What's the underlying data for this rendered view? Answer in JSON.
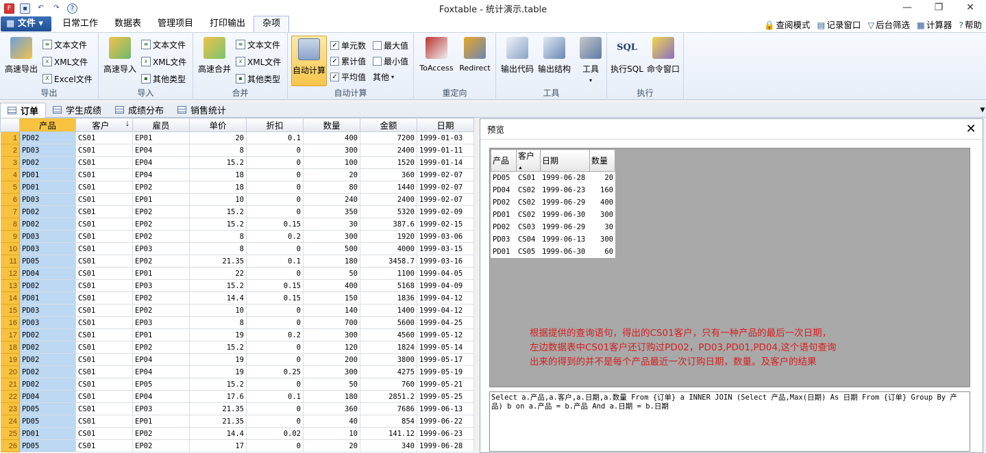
{
  "app": {
    "title": "Foxtable - 统计演示.table"
  },
  "menu": {
    "file": "文件",
    "tabs": [
      "日常工作",
      "数据表",
      "管理项目",
      "打印输出",
      "杂项"
    ],
    "active_tab": "杂项",
    "right_links": [
      "查阅模式",
      "记录窗口",
      "后台筛选",
      "计算器",
      "帮助"
    ]
  },
  "ribbon": {
    "export": {
      "label": "导出",
      "big": "高速导出",
      "small": [
        "文本文件",
        "XML文件",
        "Excel文件"
      ]
    },
    "import": {
      "label": "导入",
      "big": "高速导入",
      "small": [
        "文本文件",
        "XML文件",
        "其他类型"
      ]
    },
    "merge": {
      "label": "合并",
      "big": "高速合并",
      "small": [
        "文本文件",
        "XML文件",
        "其他类型"
      ]
    },
    "autocalc": {
      "label": "自动计算",
      "big": "自动计算",
      "checks": [
        "单元数",
        "累计值",
        "平均值"
      ],
      "checks2": [
        "最大值",
        "最小值"
      ],
      "other": "其他"
    },
    "redirect": {
      "label": "重定向",
      "items": [
        "ToAccess",
        "Redirect"
      ]
    },
    "tools": {
      "label": "工具",
      "items": [
        "输出代码",
        "输出结构",
        "工具"
      ]
    },
    "exec": {
      "label": "执行",
      "items": [
        "执行SQL",
        "命令窗口"
      ]
    }
  },
  "doc_tabs": [
    "订单",
    "学生成绩",
    "成绩分布",
    "销售统计"
  ],
  "grid": {
    "columns": [
      "产品",
      "客户",
      "雇员",
      "单价",
      "折扣",
      "数量",
      "金额",
      "日期"
    ],
    "rows": [
      [
        "1",
        "PD02",
        "CS01",
        "EP01",
        "20",
        "0.1",
        "400",
        "7200",
        "1999-01-03"
      ],
      [
        "2",
        "PD03",
        "CS01",
        "EP04",
        "8",
        "0",
        "300",
        "2400",
        "1999-01-11"
      ],
      [
        "3",
        "PD02",
        "CS01",
        "EP04",
        "15.2",
        "0",
        "100",
        "1520",
        "1999-01-14"
      ],
      [
        "4",
        "PD01",
        "CS01",
        "EP04",
        "18",
        "0",
        "20",
        "360",
        "1999-02-07"
      ],
      [
        "5",
        "PD01",
        "CS01",
        "EP02",
        "18",
        "0",
        "80",
        "1440",
        "1999-02-07"
      ],
      [
        "6",
        "PD03",
        "CS01",
        "EP01",
        "10",
        "0",
        "240",
        "2400",
        "1999-02-07"
      ],
      [
        "7",
        "PD02",
        "CS01",
        "EP02",
        "15.2",
        "0",
        "350",
        "5320",
        "1999-02-09"
      ],
      [
        "8",
        "PD02",
        "CS01",
        "EP02",
        "15.2",
        "0.15",
        "30",
        "387.6",
        "1999-02-15"
      ],
      [
        "9",
        "PD03",
        "CS01",
        "EP02",
        "8",
        "0.2",
        "300",
        "1920",
        "1999-03-06"
      ],
      [
        "10",
        "PD03",
        "CS01",
        "EP03",
        "8",
        "0",
        "500",
        "4000",
        "1999-03-15"
      ],
      [
        "11",
        "PD05",
        "CS01",
        "EP02",
        "21.35",
        "0.1",
        "180",
        "3458.7",
        "1999-03-16"
      ],
      [
        "12",
        "PD04",
        "CS01",
        "EP01",
        "22",
        "0",
        "50",
        "1100",
        "1999-04-05"
      ],
      [
        "13",
        "PD02",
        "CS01",
        "EP03",
        "15.2",
        "0.15",
        "400",
        "5168",
        "1999-04-09"
      ],
      [
        "14",
        "PD01",
        "CS01",
        "EP02",
        "14.4",
        "0.15",
        "150",
        "1836",
        "1999-04-12"
      ],
      [
        "15",
        "PD03",
        "CS01",
        "EP02",
        "10",
        "0",
        "140",
        "1400",
        "1999-04-12"
      ],
      [
        "16",
        "PD03",
        "CS01",
        "EP03",
        "8",
        "0",
        "700",
        "5600",
        "1999-04-25"
      ],
      [
        "17",
        "PD02",
        "CS01",
        "EP01",
        "19",
        "0.2",
        "300",
        "4560",
        "1999-05-12"
      ],
      [
        "18",
        "PD02",
        "CS01",
        "EP02",
        "15.2",
        "0",
        "120",
        "1824",
        "1999-05-14"
      ],
      [
        "19",
        "PD02",
        "CS01",
        "EP04",
        "19",
        "0",
        "200",
        "3800",
        "1999-05-17"
      ],
      [
        "20",
        "PD02",
        "CS01",
        "EP04",
        "19",
        "0.25",
        "300",
        "4275",
        "1999-05-19"
      ],
      [
        "21",
        "PD02",
        "CS01",
        "EP05",
        "15.2",
        "0",
        "50",
        "760",
        "1999-05-21"
      ],
      [
        "22",
        "PD04",
        "CS01",
        "EP04",
        "17.6",
        "0.1",
        "180",
        "2851.2",
        "1999-05-25"
      ],
      [
        "23",
        "PD05",
        "CS01",
        "EP03",
        "21.35",
        "0",
        "360",
        "7686",
        "1999-06-13"
      ],
      [
        "24",
        "PD05",
        "CS01",
        "EP01",
        "21.35",
        "0",
        "40",
        "854",
        "1999-06-22"
      ],
      [
        "25",
        "PD01",
        "CS01",
        "EP02",
        "14.4",
        "0.02",
        "10",
        "141.12",
        "1999-06-23"
      ],
      [
        "26",
        "PD05",
        "CS01",
        "EP02",
        "17",
        "0",
        "20",
        "340",
        "1999-06-28"
      ]
    ]
  },
  "preview": {
    "title": "预览",
    "columns": [
      "产品",
      "客户",
      "日期",
      "数量"
    ],
    "rows": [
      [
        "PD05",
        "CS01",
        "1999-06-28",
        "20"
      ],
      [
        "PD04",
        "CS02",
        "1999-06-23",
        "160"
      ],
      [
        "PD02",
        "CS02",
        "1999-06-29",
        "400"
      ],
      [
        "PD01",
        "CS02",
        "1999-06-30",
        "300"
      ],
      [
        "PD02",
        "CS03",
        "1999-06-29",
        "30"
      ],
      [
        "PD03",
        "CS04",
        "1999-06-13",
        "300"
      ],
      [
        "PD01",
        "CS05",
        "1999-06-30",
        "60"
      ]
    ],
    "note": "根据提供的查询语句，得出的CS01客户，只有一种产品的最后一次日期，\n左边数据表中CS01客户还订购过PD02，PD03,PD01,PD04,这个语句查询\n出来的得到的并不是每个产品最近一次订购日期，数量。及客户的结果",
    "sql": "Select a.产品,a.客户,a.日期,a.数量 From {订单} a INNER JOIN (Select 产品,Max(日期) As 日期 From {订单} Group By 产品) b on a.产品 = b.产品 And a.日期 = b.日期"
  }
}
